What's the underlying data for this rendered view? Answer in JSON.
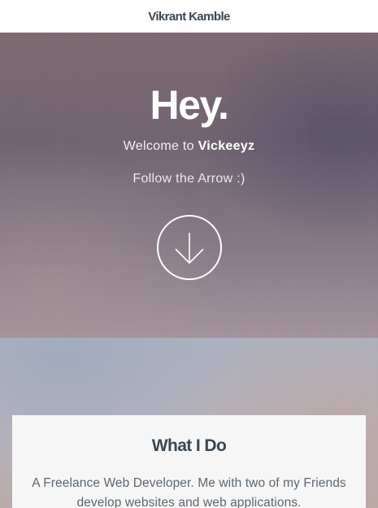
{
  "header": {
    "brand": "Vikrant Kamble"
  },
  "hero": {
    "title": "Hey.",
    "welcome_prefix": "Welcome to ",
    "welcome_name": "Vickeeyz",
    "follow_text": "Follow the Arrow :)",
    "arrow_icon": "arrow-down-icon"
  },
  "about": {
    "title": "What I Do",
    "text": "A Freelance Web Developer. Me with two of my Friends develop websites and web applications."
  },
  "colors": {
    "brand_text": "#3b4751",
    "card_background": "#f6f6f6",
    "hero_text": "#ffffff"
  }
}
